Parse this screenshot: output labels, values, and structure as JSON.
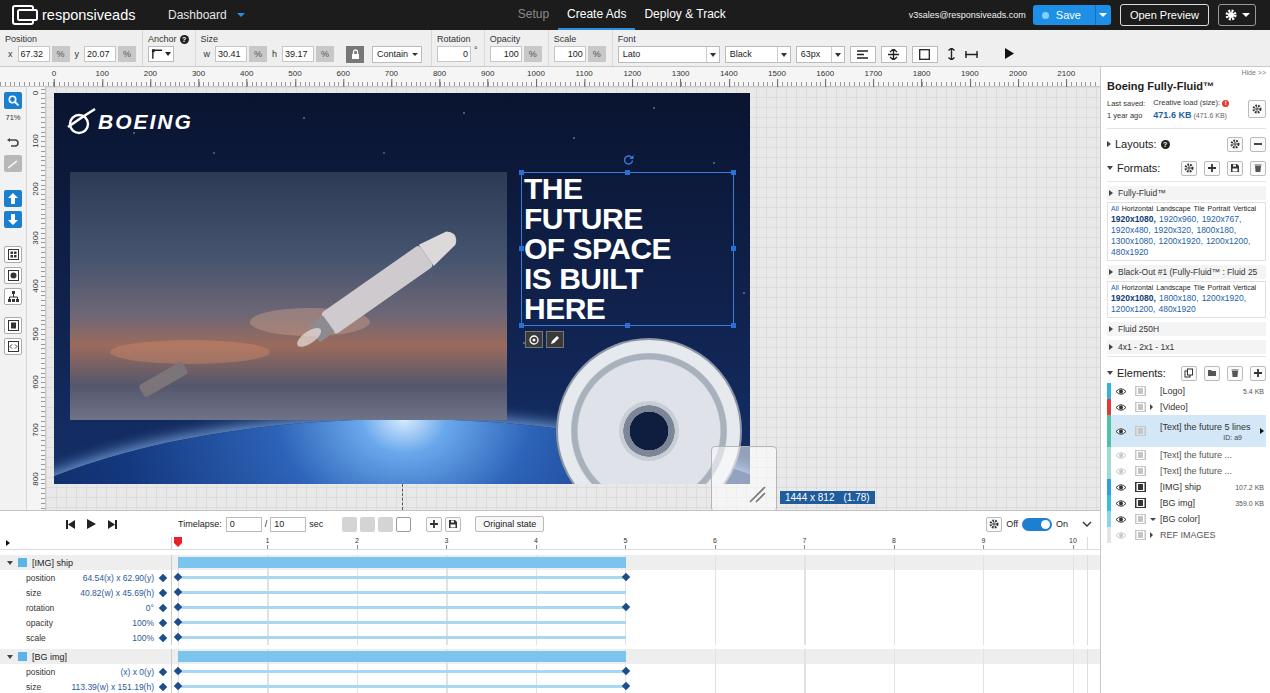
{
  "nav": {
    "brand": "responsiveads",
    "dashboard": "Dashboard",
    "tabs": [
      {
        "label": "Setup",
        "selected": false,
        "disabled": true
      },
      {
        "label": "Create Ads",
        "selected": true,
        "disabled": false
      },
      {
        "label": "Deploy & Track",
        "selected": false,
        "disabled": false
      }
    ],
    "user": "v3sales@responsiveads.com",
    "save": "Save",
    "preview": "Open Preview"
  },
  "toolbar": {
    "position": {
      "label": "Position",
      "x_label": "x",
      "x": "67.32",
      "y_label": "y",
      "y": "20.07",
      "unit": "%"
    },
    "anchor": {
      "label": "Anchor",
      "help": "?"
    },
    "size": {
      "label": "Size",
      "w_label": "w",
      "w": "30.41",
      "h_label": "h",
      "h": "39.17",
      "unit": "%",
      "locked": true,
      "fit": "Contain"
    },
    "rotation": {
      "label": "Rotation",
      "value": "0",
      "unit": "°"
    },
    "opacity": {
      "label": "Opacity",
      "value": "100",
      "unit": "%"
    },
    "scale": {
      "label": "Scale",
      "value": "100",
      "unit": "%"
    },
    "font": {
      "label": "Font",
      "family": "Lato",
      "weight": "Black",
      "size": "63px"
    }
  },
  "ruler": {
    "h_ticks": [
      "0",
      "100",
      "200",
      "300",
      "400",
      "500",
      "600",
      "700",
      "800",
      "900",
      "1000",
      "1100",
      "1200",
      "1300",
      "1400",
      "1500",
      "1600",
      "1700",
      "1800",
      "1900",
      "2000",
      "2100"
    ],
    "v_ticks": [
      "0",
      "100",
      "200",
      "300",
      "400",
      "500",
      "600",
      "700",
      "800"
    ]
  },
  "tools": {
    "zoom": "71%"
  },
  "canvas": {
    "logo": "BOEING",
    "headline": [
      "THE",
      "FUTURE",
      "OF SPACE",
      "IS BUILT",
      "HERE"
    ],
    "dimensions": "1444 x 812",
    "ratio": "(1.78)"
  },
  "panel": {
    "hide": "Hide >>",
    "title": "Boeing Fully-Fluid™",
    "last_saved_label": "Last saved:",
    "last_saved": "1 year ago",
    "load_label": "Creative load (size):",
    "load_alert": "!",
    "load": "471.6 KB",
    "load_detail": "(471.6 KB)",
    "layouts": {
      "label": "Layouts:",
      "help": "?",
      "expanded": false
    },
    "formats": {
      "label": "Formats:",
      "expanded": true,
      "groups": [
        {
          "name": "Fully-Fluid™",
          "expanded": false,
          "orientations": [
            {
              "label": "All",
              "selected": true
            },
            {
              "label": "Horizontal",
              "selected": false
            },
            {
              "label": "Landscape",
              "selected": false
            },
            {
              "label": "Tile",
              "selected": false
            },
            {
              "label": "Portrait",
              "selected": false
            },
            {
              "label": "Vertical",
              "selected": false
            }
          ],
          "sizes": [
            {
              "label": "1920x1080,",
              "selected": true
            },
            {
              "label": "1920x960,",
              "selected": false
            },
            {
              "label": "1920x767,",
              "selected": false
            },
            {
              "label": "1920x480,",
              "selected": false
            },
            {
              "label": "1920x320,",
              "selected": false
            },
            {
              "label": "1800x180,",
              "selected": false
            },
            {
              "label": "1300x1080,",
              "selected": false
            },
            {
              "label": "1200x1920,",
              "selected": false
            },
            {
              "label": "1200x1200,",
              "selected": false
            },
            {
              "label": "480x1920",
              "selected": false
            }
          ]
        },
        {
          "name": "Black-Out #1 (Fully-Fluid™ : Fluid 25",
          "expanded": false,
          "orientations": [
            {
              "label": "All",
              "selected": true
            },
            {
              "label": "Horizontal",
              "selected": false
            },
            {
              "label": "Landscape",
              "selected": false
            },
            {
              "label": "Tile",
              "selected": false
            },
            {
              "label": "Portrait",
              "selected": false
            },
            {
              "label": "Vertical",
              "selected": false
            }
          ],
          "sizes": [
            {
              "label": "1920x1080,",
              "selected": true
            },
            {
              "label": "1800x180,",
              "selected": false
            },
            {
              "label": "1200x1920,",
              "selected": false
            },
            {
              "label": "1200x1200,",
              "selected": false
            },
            {
              "label": "480x1920",
              "selected": false
            }
          ]
        },
        {
          "name": "Fluid 250H",
          "expanded": false,
          "orientations": [],
          "sizes": []
        },
        {
          "name": "4x1 - 2x1 - 1x1",
          "expanded": false,
          "orientations": [],
          "sizes": []
        }
      ]
    },
    "elements": {
      "label": "Elements:",
      "expanded": true,
      "items": [
        {
          "name": "[Logo]",
          "size": "5.4 KB",
          "id": "",
          "visible": true,
          "animated": false,
          "selected": false,
          "expandable": false,
          "expanded": false,
          "color": "#31b4d8"
        },
        {
          "name": "[Video]",
          "size": "",
          "id": "",
          "visible": true,
          "animated": false,
          "selected": false,
          "expandable": true,
          "expanded": false,
          "color": "#e53935"
        },
        {
          "name": "[Text] the future 5 lines",
          "size": "",
          "id": "ID: a9",
          "visible": true,
          "animated": false,
          "selected": true,
          "expandable": false,
          "expanded": false,
          "color": "#4fc3a1"
        },
        {
          "name": "[Text] the future ...",
          "size": "",
          "id": "",
          "visible": false,
          "animated": false,
          "selected": false,
          "expandable": false,
          "expanded": false,
          "color": "#9fdcd0"
        },
        {
          "name": "[Text] the future ...",
          "size": "",
          "id": "",
          "visible": false,
          "animated": false,
          "selected": false,
          "expandable": false,
          "expanded": false,
          "color": "#9fdcd0"
        },
        {
          "name": "[IMG] ship",
          "size": "107.2 KB",
          "id": "",
          "visible": true,
          "animated": true,
          "selected": false,
          "expandable": false,
          "expanded": false,
          "color": "#2f9fe0"
        },
        {
          "name": "[BG img]",
          "size": "359.0 KB",
          "id": "",
          "visible": true,
          "animated": true,
          "selected": false,
          "expandable": false,
          "expanded": false,
          "color": "#39c0d8"
        },
        {
          "name": "[BG color]",
          "size": "",
          "id": "",
          "visible": true,
          "animated": false,
          "selected": false,
          "expandable": true,
          "expanded": true,
          "color": "#8fd3e6"
        },
        {
          "name": "REF IMAGES",
          "size": "",
          "id": "",
          "visible": false,
          "animated": false,
          "selected": false,
          "expandable": true,
          "expanded": false,
          "color": "#e4e4e4"
        }
      ]
    }
  },
  "timeline": {
    "timelapse_label": "Timelapse:",
    "current": "0",
    "separator": "/",
    "total": "10",
    "unit": "sec",
    "original_state": "Original state",
    "all_expanded": false,
    "toggle": {
      "off": "Off",
      "on": "On",
      "on_state": true
    },
    "ticks": [
      "1",
      "2",
      "3",
      "4",
      "5",
      "6",
      "7",
      "8",
      "9",
      "10"
    ],
    "playhead": 0,
    "tracks": [
      {
        "name": "[IMG] ship",
        "color": "#5ab4e6",
        "expanded": true,
        "start": 0,
        "end": 5,
        "props": [
          {
            "label": "position",
            "value": "64.54(x) x 62.90(y)",
            "keyframes": [
              0,
              5
            ]
          },
          {
            "label": "size",
            "value": "40.82(w) x 45.69(h)",
            "keyframes": [
              0
            ]
          },
          {
            "label": "rotation",
            "value": "0°",
            "keyframes": [
              0,
              5
            ]
          },
          {
            "label": "opacity",
            "value": "100%",
            "keyframes": [
              0
            ]
          },
          {
            "label": "scale",
            "value": "100%",
            "keyframes": [
              0
            ]
          }
        ]
      },
      {
        "name": "[BG img]",
        "color": "#5ab4e6",
        "expanded": true,
        "start": 0,
        "end": 5,
        "props": [
          {
            "label": "position",
            "value": "(x) x 0(y)",
            "keyframes": [
              0,
              5
            ]
          },
          {
            "label": "size",
            "value": "113.39(w) x 151.19(h)",
            "keyframes": [
              0,
              5
            ]
          }
        ]
      }
    ]
  }
}
